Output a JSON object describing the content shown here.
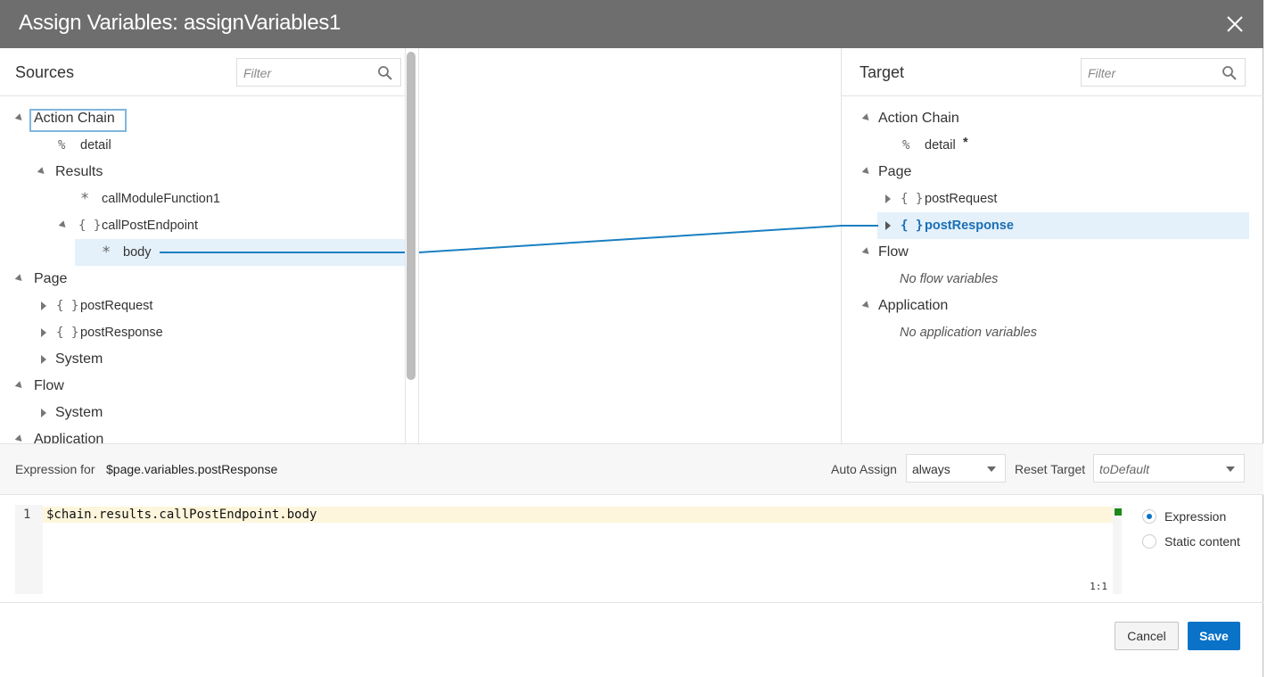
{
  "title": "Assign Variables: assignVariables1",
  "sources": {
    "heading": "Sources",
    "filter_placeholder": "Filter",
    "tree": [
      {
        "label": "Action Chain",
        "icon": "",
        "focused": true
      },
      {
        "label": "detail",
        "icon": "%"
      },
      {
        "label": "Results",
        "icon": ""
      },
      {
        "label": "callModuleFunction1",
        "icon": "*"
      },
      {
        "label": "callPostEndpoint",
        "icon": "{}"
      },
      {
        "label": "body",
        "icon": "*",
        "selected": true
      },
      {
        "label": "Page",
        "icon": ""
      },
      {
        "label": "postRequest",
        "icon": "{}"
      },
      {
        "label": "postResponse",
        "icon": "{}"
      },
      {
        "label": "System",
        "icon": ""
      },
      {
        "label": "Flow",
        "icon": ""
      },
      {
        "label": "System",
        "icon": ""
      },
      {
        "label": "Application",
        "icon": ""
      }
    ]
  },
  "target": {
    "heading": "Target",
    "filter_placeholder": "Filter",
    "tree": [
      {
        "label": "Action Chain",
        "icon": ""
      },
      {
        "label": "detail",
        "icon": "%",
        "suffix": "*"
      },
      {
        "label": "Page",
        "icon": ""
      },
      {
        "label": "postRequest",
        "icon": "{}"
      },
      {
        "label": "postResponse",
        "icon": "{}",
        "selected": true
      },
      {
        "label": "Flow",
        "icon": ""
      },
      {
        "label": "No flow variables",
        "icon": ""
      },
      {
        "label": "Application",
        "icon": ""
      },
      {
        "label": "No application variables",
        "icon": ""
      }
    ]
  },
  "expression": {
    "label": "Expression for",
    "path": "$page.variables.postResponse",
    "auto_assign_label": "Auto Assign",
    "auto_assign_value": "always",
    "reset_target_label": "Reset Target",
    "reset_target_value": "toDefault"
  },
  "editor": {
    "line_number": "1",
    "code": "$chain.results.callPostEndpoint.body",
    "cursor_pos": "1:1"
  },
  "mode": {
    "options": [
      "Expression",
      "Static content"
    ],
    "selected": "Expression"
  },
  "footer": {
    "cancel_label": "Cancel",
    "save_label": "Save"
  },
  "colors": {
    "titlebar": "#6e6e6e",
    "accent": "#0a72c7",
    "selection": "#e4f0fa",
    "mapping_line": "#1a7fc1"
  }
}
